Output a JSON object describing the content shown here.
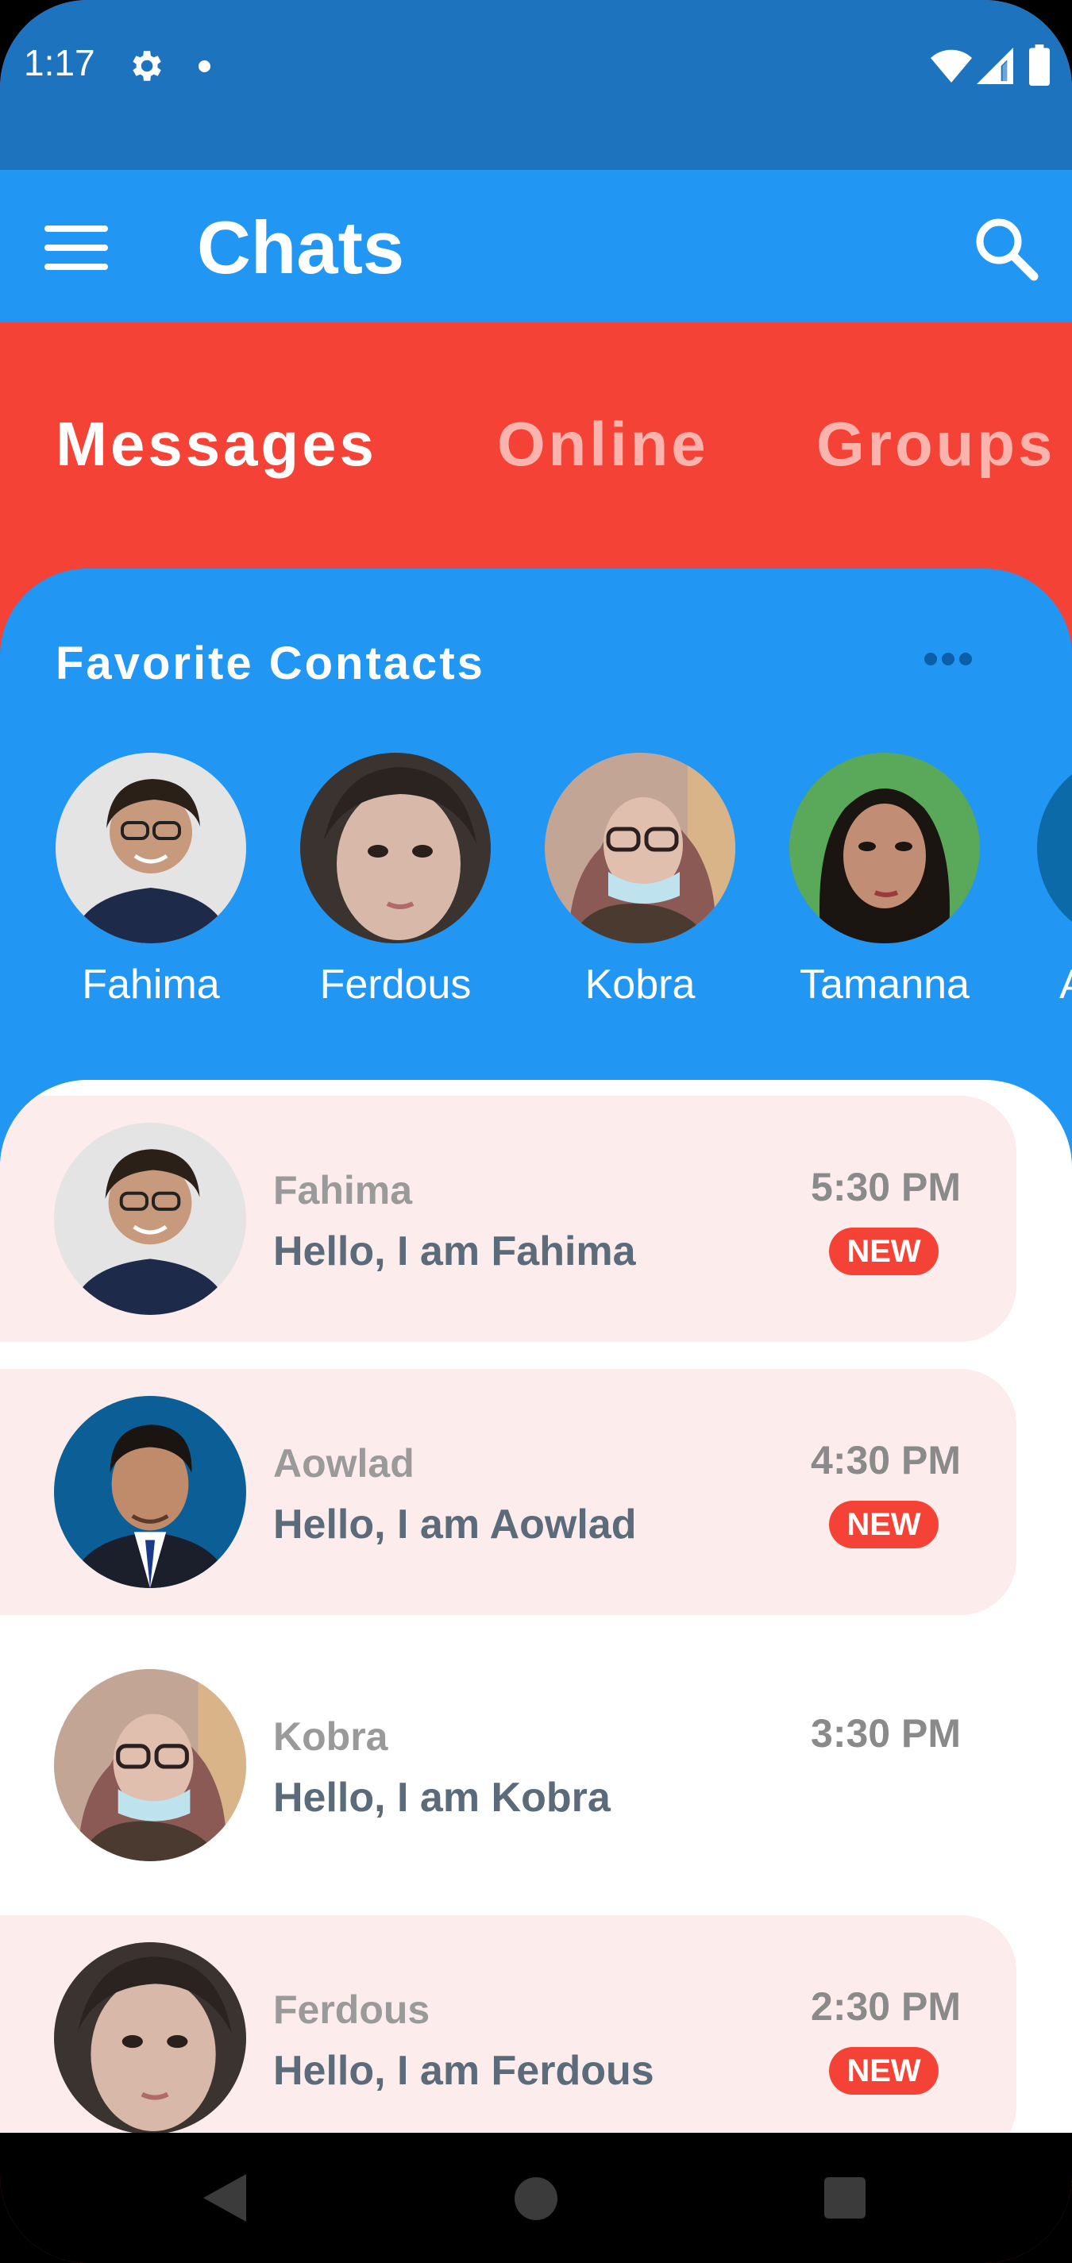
{
  "status_bar": {
    "time": "1:17",
    "icons": [
      "settings-gear-icon",
      "notification-dot-icon",
      "wifi-icon",
      "cell-signal-icon",
      "battery-icon"
    ]
  },
  "app_bar": {
    "title": "Chats",
    "menu_icon": "hamburger-menu-icon",
    "search_icon": "search-icon",
    "color": "#2196f3"
  },
  "tabs": [
    {
      "label": "Messages",
      "active": true
    },
    {
      "label": "Online",
      "active": false
    },
    {
      "label": "Groups",
      "active": false
    }
  ],
  "favorites": {
    "title": "Favorite Contacts",
    "more_icon": "more-horizontal-icon",
    "contacts": [
      {
        "name": "Fahima"
      },
      {
        "name": "Ferdous"
      },
      {
        "name": "Kobra"
      },
      {
        "name": "Tamanna"
      },
      {
        "name": "A"
      }
    ]
  },
  "chats": [
    {
      "name": "Fahima",
      "message": "Hello, I am Fahima",
      "time": "5:30 PM",
      "unread": true,
      "badge": "NEW"
    },
    {
      "name": "Aowlad",
      "message": "Hello, I am Aowlad",
      "time": "4:30 PM",
      "unread": true,
      "badge": "NEW"
    },
    {
      "name": "Kobra",
      "message": "Hello, I am Kobra",
      "time": "3:30 PM",
      "unread": false,
      "badge": ""
    },
    {
      "name": "Ferdous",
      "message": "Hello, I am Ferdous",
      "time": "2:30 PM",
      "unread": true,
      "badge": "NEW"
    }
  ],
  "nav_bar": {
    "icons": [
      "back-icon",
      "home-icon",
      "recents-icon"
    ]
  },
  "colors": {
    "status_bar": "#1e73bf",
    "primary": "#2196f3",
    "accent": "#f44336",
    "unread_row": "#fdecec"
  }
}
